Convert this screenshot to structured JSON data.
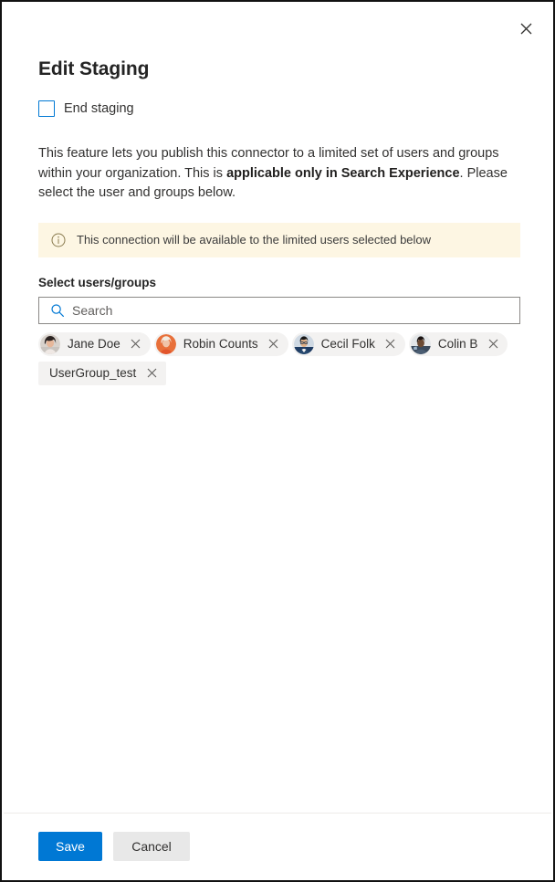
{
  "panel": {
    "title": "Edit Staging",
    "close_label": "Close",
    "close_icon": "close-icon"
  },
  "end_staging": {
    "label": "End staging",
    "checked": false
  },
  "description": {
    "part1": "This feature lets you publish this connector to a limited set of users and groups within your organization. This is ",
    "emphasis": "applicable only in Search Experience",
    "part2": ". Please select the user and groups below."
  },
  "info_banner": {
    "icon": "info-circle-icon",
    "text": "This connection will be available to the limited users selected below",
    "background_color": "#fdf6e3"
  },
  "picker": {
    "label": "Select users/groups",
    "search": {
      "icon": "search-icon",
      "placeholder": "Search",
      "value": ""
    },
    "chips": [
      {
        "name": "Jane Doe",
        "type": "person",
        "avatar": "avatar-jane-doe",
        "remove_icon": "close-icon"
      },
      {
        "name": "Robin Counts",
        "type": "person",
        "avatar": "avatar-robin-counts",
        "remove_icon": "close-icon"
      },
      {
        "name": "Cecil Folk",
        "type": "person",
        "avatar": "avatar-cecil-folk",
        "remove_icon": "close-icon"
      },
      {
        "name": "Colin B",
        "type": "person",
        "avatar": "avatar-colin-b",
        "remove_icon": "close-icon"
      },
      {
        "name": "UserGroup_test",
        "type": "group",
        "avatar": null,
        "remove_icon": "close-icon"
      }
    ]
  },
  "footer": {
    "save_label": "Save",
    "cancel_label": "Cancel",
    "primary_color": "#0078d4",
    "secondary_color": "#e8e8e8"
  }
}
